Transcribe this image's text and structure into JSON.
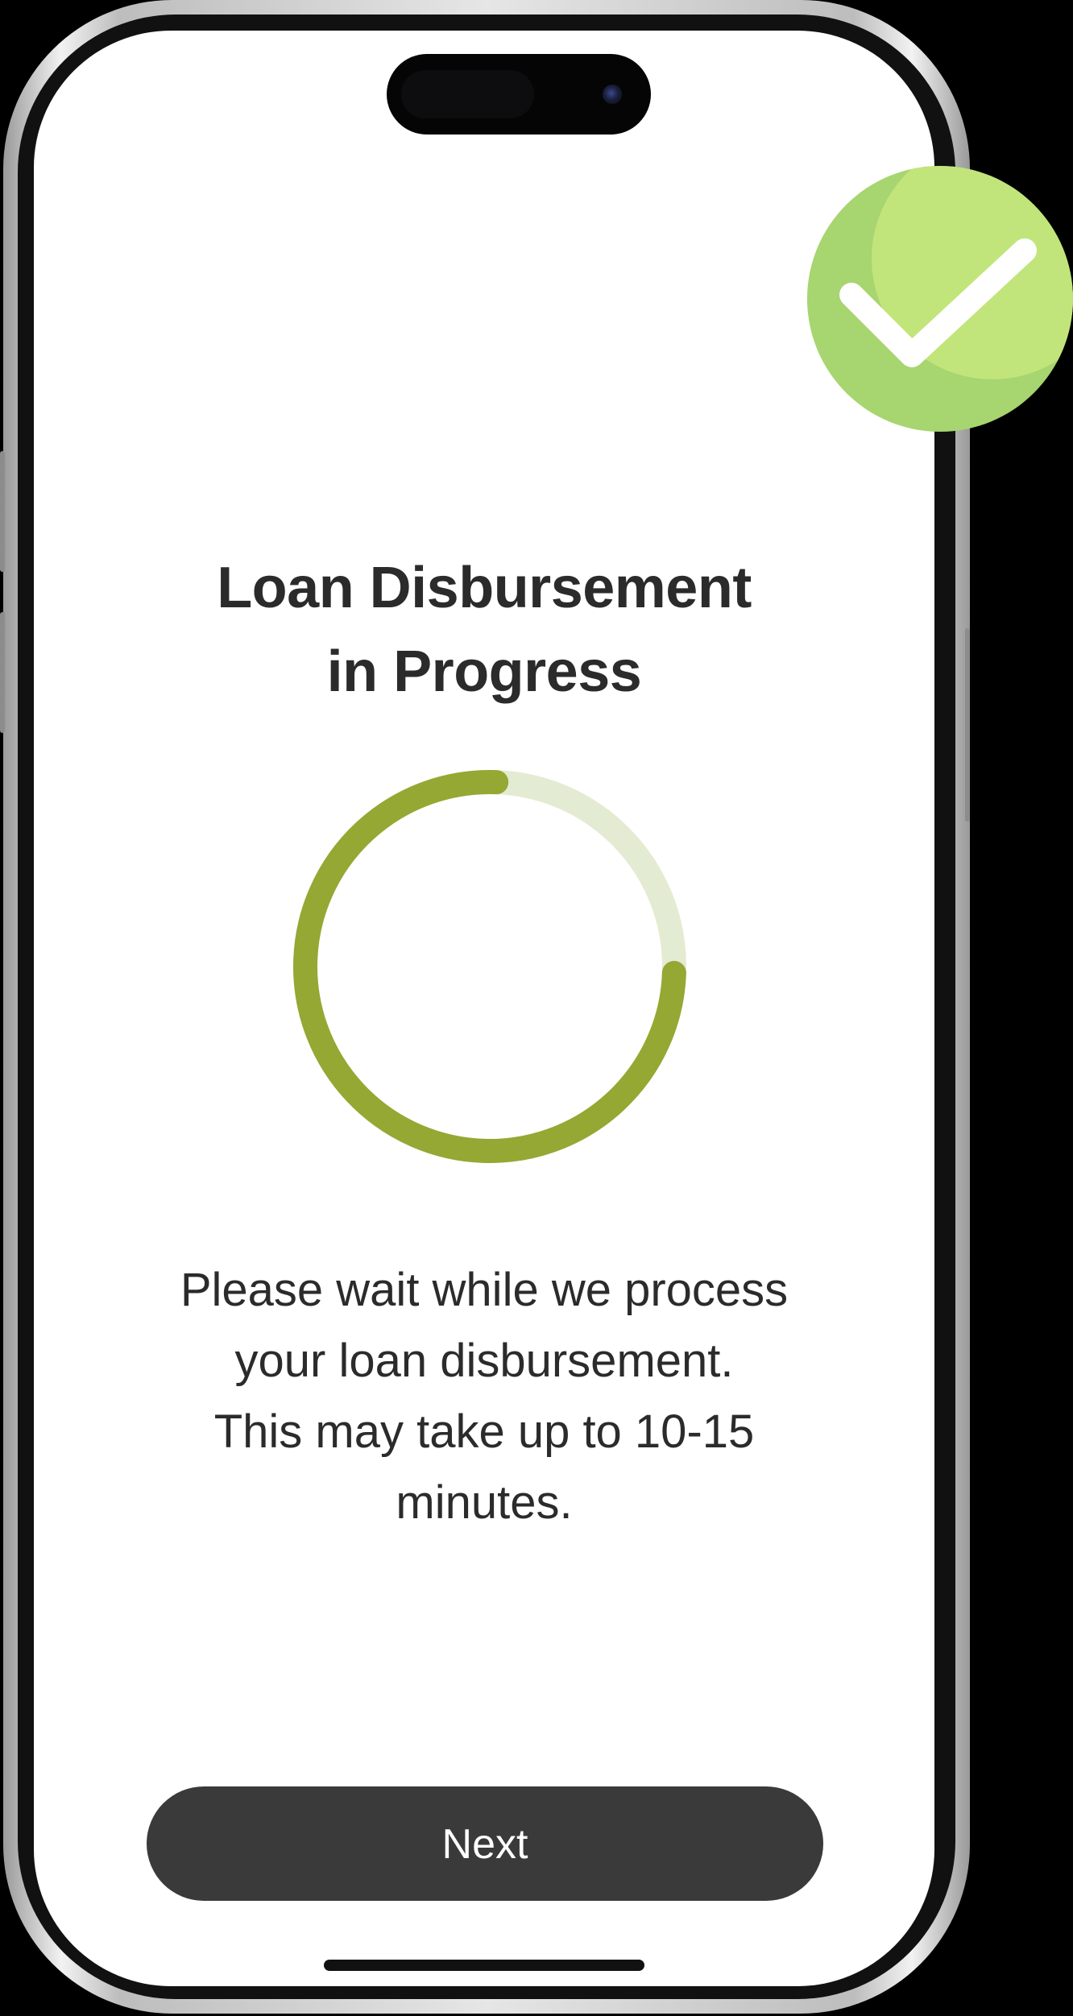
{
  "screen": {
    "title_lines": [
      "Loan Disbursement",
      "in Progress"
    ],
    "message_lines": [
      "Please wait while we process",
      "your loan disbursement.",
      "This may take up to 10-15",
      "minutes."
    ],
    "next_label": "Next"
  },
  "progress": {
    "fraction": 0.75
  },
  "colors": {
    "progress_fill": "#94a833",
    "progress_track": "#e4ebd3",
    "button_bg": "#3a3a3a",
    "check_badge": "#a7d56f",
    "check_badge_highlight": "#c1e57a",
    "text": "#2b2b2b"
  },
  "icons": {
    "badge": "checkmark-badge-icon",
    "status": "loading-spinner-icon"
  }
}
